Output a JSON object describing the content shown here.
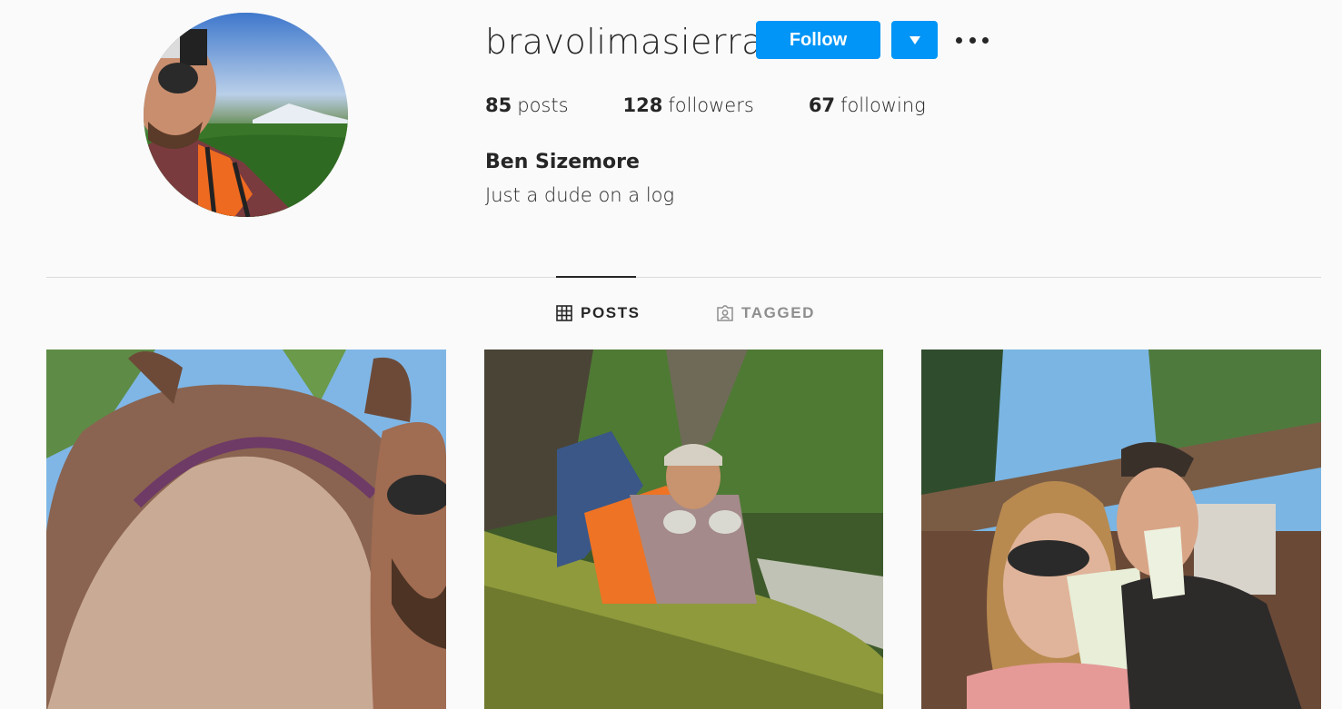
{
  "profile": {
    "username": "bravolimasierra",
    "full_name": "Ben Sizemore",
    "bio": "Just a dude on a log",
    "avatar_icon": "profile-photo"
  },
  "actions": {
    "follow_label": "Follow",
    "dropdown_icon": "chevron-down-icon",
    "more_icon": "more-options-icon"
  },
  "stats": [
    {
      "count": "85",
      "label": "posts"
    },
    {
      "count": "128",
      "label": "followers"
    },
    {
      "count": "67",
      "label": "following"
    }
  ],
  "tabs": [
    {
      "label": "POSTS",
      "icon": "grid-icon",
      "active": true
    },
    {
      "label": "TAGGED",
      "icon": "tagged-icon",
      "active": false
    }
  ],
  "posts": [
    {
      "subject": "horse-selfie"
    },
    {
      "subject": "man-on-mossy-log"
    },
    {
      "subject": "couple-drinking"
    }
  ],
  "colors": {
    "accent": "#0095f6",
    "background": "#fafafa",
    "text": "#262626",
    "muted": "#8e8e8e",
    "divider": "#dbdbdb"
  }
}
